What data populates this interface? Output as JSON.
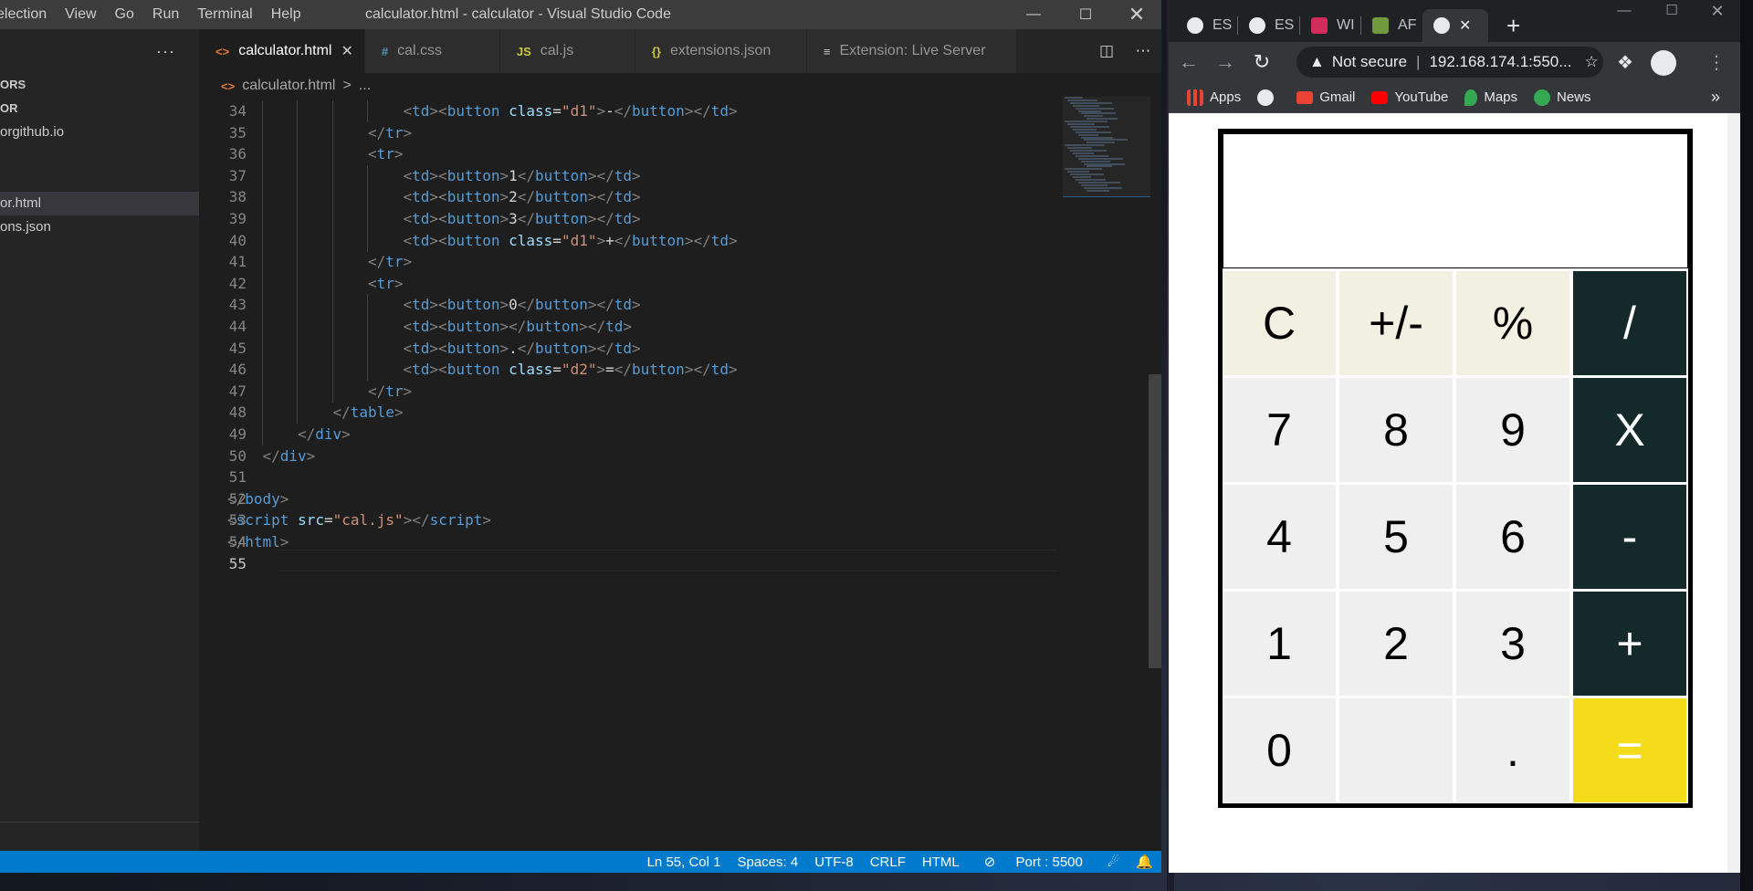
{
  "vscode": {
    "menu": [
      "election",
      "View",
      "Go",
      "Run",
      "Terminal",
      "Help"
    ],
    "title": "calculator.html - calculator - Visual Studio Code",
    "sidebar": {
      "more": "···",
      "rows": [
        "ORS",
        "OR",
        "orgithub.io",
        "",
        "",
        "or.html",
        "ons.json"
      ]
    },
    "tabs": [
      {
        "icon": "<>",
        "label": "calculator.html",
        "close": "✕"
      },
      {
        "icon": "#",
        "label": "cal.css"
      },
      {
        "icon": "JS",
        "label": "cal.js"
      },
      {
        "icon": "{}",
        "label": "extensions.json"
      },
      {
        "icon": "≡",
        "label": "Extension: Live Server"
      }
    ],
    "breadcrumb": {
      "file": "calculator.html",
      "sep": ">",
      "more": "..."
    },
    "status": {
      "position": "Ln 55, Col 1",
      "spaces": "Spaces: 4",
      "encoding": "UTF-8",
      "eol": "CRLF",
      "language": "HTML",
      "port": "Port : 5500"
    }
  },
  "code_lines": [
    {
      "n": "34",
      "indent": 5,
      "tokens": [
        [
          "p",
          "<"
        ],
        [
          "t",
          "td"
        ],
        [
          "p",
          ">"
        ],
        [
          "p",
          "<"
        ],
        [
          "t",
          "button"
        ],
        [
          "x",
          " "
        ],
        [
          "a",
          "class"
        ],
        [
          "x",
          "="
        ],
        [
          "s",
          "\"d1\""
        ],
        [
          "p",
          ">"
        ],
        [
          "x",
          "-"
        ],
        [
          "p",
          "</"
        ],
        [
          "t",
          "button"
        ],
        [
          "p",
          "></"
        ],
        [
          "t",
          "td"
        ],
        [
          "p",
          ">"
        ]
      ]
    },
    {
      "n": "35",
      "indent": 4,
      "tokens": [
        [
          "p",
          "</"
        ],
        [
          "t",
          "tr"
        ],
        [
          "p",
          ">"
        ]
      ]
    },
    {
      "n": "36",
      "indent": 4,
      "tokens": [
        [
          "p",
          "<"
        ],
        [
          "t",
          "tr"
        ],
        [
          "p",
          ">"
        ]
      ]
    },
    {
      "n": "37",
      "indent": 5,
      "tokens": [
        [
          "p",
          "<"
        ],
        [
          "t",
          "td"
        ],
        [
          "p",
          ">"
        ],
        [
          "p",
          "<"
        ],
        [
          "t",
          "button"
        ],
        [
          "p",
          ">"
        ],
        [
          "x",
          "1"
        ],
        [
          "p",
          "</"
        ],
        [
          "t",
          "button"
        ],
        [
          "p",
          "></"
        ],
        [
          "t",
          "td"
        ],
        [
          "p",
          ">"
        ]
      ]
    },
    {
      "n": "38",
      "indent": 5,
      "tokens": [
        [
          "p",
          "<"
        ],
        [
          "t",
          "td"
        ],
        [
          "p",
          ">"
        ],
        [
          "p",
          "<"
        ],
        [
          "t",
          "button"
        ],
        [
          "p",
          ">"
        ],
        [
          "x",
          "2"
        ],
        [
          "p",
          "</"
        ],
        [
          "t",
          "button"
        ],
        [
          "p",
          "></"
        ],
        [
          "t",
          "td"
        ],
        [
          "p",
          ">"
        ]
      ]
    },
    {
      "n": "39",
      "indent": 5,
      "tokens": [
        [
          "p",
          "<"
        ],
        [
          "t",
          "td"
        ],
        [
          "p",
          ">"
        ],
        [
          "p",
          "<"
        ],
        [
          "t",
          "button"
        ],
        [
          "p",
          ">"
        ],
        [
          "x",
          "3"
        ],
        [
          "p",
          "</"
        ],
        [
          "t",
          "button"
        ],
        [
          "p",
          "></"
        ],
        [
          "t",
          "td"
        ],
        [
          "p",
          ">"
        ]
      ]
    },
    {
      "n": "40",
      "indent": 5,
      "tokens": [
        [
          "p",
          "<"
        ],
        [
          "t",
          "td"
        ],
        [
          "p",
          ">"
        ],
        [
          "p",
          "<"
        ],
        [
          "t",
          "button"
        ],
        [
          "x",
          " "
        ],
        [
          "a",
          "class"
        ],
        [
          "x",
          "="
        ],
        [
          "s",
          "\"d1\""
        ],
        [
          "p",
          ">"
        ],
        [
          "x",
          "+"
        ],
        [
          "p",
          "</"
        ],
        [
          "t",
          "button"
        ],
        [
          "p",
          "></"
        ],
        [
          "t",
          "td"
        ],
        [
          "p",
          ">"
        ]
      ]
    },
    {
      "n": "41",
      "indent": 4,
      "tokens": [
        [
          "p",
          "</"
        ],
        [
          "t",
          "tr"
        ],
        [
          "p",
          ">"
        ]
      ]
    },
    {
      "n": "42",
      "indent": 4,
      "tokens": [
        [
          "p",
          "<"
        ],
        [
          "t",
          "tr"
        ],
        [
          "p",
          ">"
        ]
      ]
    },
    {
      "n": "43",
      "indent": 5,
      "tokens": [
        [
          "p",
          "<"
        ],
        [
          "t",
          "td"
        ],
        [
          "p",
          ">"
        ],
        [
          "p",
          "<"
        ],
        [
          "t",
          "button"
        ],
        [
          "p",
          ">"
        ],
        [
          "x",
          "0"
        ],
        [
          "p",
          "</"
        ],
        [
          "t",
          "button"
        ],
        [
          "p",
          "></"
        ],
        [
          "t",
          "td"
        ],
        [
          "p",
          ">"
        ]
      ]
    },
    {
      "n": "44",
      "indent": 5,
      "tokens": [
        [
          "p",
          "<"
        ],
        [
          "t",
          "td"
        ],
        [
          "p",
          ">"
        ],
        [
          "p",
          "<"
        ],
        [
          "t",
          "button"
        ],
        [
          "p",
          "></"
        ],
        [
          "t",
          "button"
        ],
        [
          "p",
          "></"
        ],
        [
          "t",
          "td"
        ],
        [
          "p",
          ">"
        ]
      ]
    },
    {
      "n": "45",
      "indent": 5,
      "tokens": [
        [
          "p",
          "<"
        ],
        [
          "t",
          "td"
        ],
        [
          "p",
          ">"
        ],
        [
          "p",
          "<"
        ],
        [
          "t",
          "button"
        ],
        [
          "p",
          ">"
        ],
        [
          "x",
          "."
        ],
        [
          "p",
          "</"
        ],
        [
          "t",
          "button"
        ],
        [
          "p",
          "></"
        ],
        [
          "t",
          "td"
        ],
        [
          "p",
          ">"
        ]
      ]
    },
    {
      "n": "46",
      "indent": 5,
      "tokens": [
        [
          "p",
          "<"
        ],
        [
          "t",
          "td"
        ],
        [
          "p",
          ">"
        ],
        [
          "p",
          "<"
        ],
        [
          "t",
          "button"
        ],
        [
          "x",
          " "
        ],
        [
          "a",
          "class"
        ],
        [
          "x",
          "="
        ],
        [
          "s",
          "\"d2\""
        ],
        [
          "p",
          ">"
        ],
        [
          "x",
          "="
        ],
        [
          "p",
          "</"
        ],
        [
          "t",
          "button"
        ],
        [
          "p",
          "></"
        ],
        [
          "t",
          "td"
        ],
        [
          "p",
          ">"
        ]
      ]
    },
    {
      "n": "47",
      "indent": 4,
      "tokens": [
        [
          "p",
          "</"
        ],
        [
          "t",
          "tr"
        ],
        [
          "p",
          ">"
        ]
      ]
    },
    {
      "n": "48",
      "indent": 3,
      "tokens": [
        [
          "p",
          "</"
        ],
        [
          "t",
          "table"
        ],
        [
          "p",
          ">"
        ]
      ]
    },
    {
      "n": "49",
      "indent": 2,
      "tokens": [
        [
          "p",
          "</"
        ],
        [
          "t",
          "div"
        ],
        [
          "p",
          ">"
        ]
      ]
    },
    {
      "n": "50",
      "indent": 1,
      "tokens": [
        [
          "p",
          "</"
        ],
        [
          "t",
          "div"
        ],
        [
          "p",
          ">"
        ]
      ]
    },
    {
      "n": "51",
      "indent": 0,
      "tokens": []
    },
    {
      "n": "52",
      "indent": 0,
      "tokens": [
        [
          "p",
          "</"
        ],
        [
          "t",
          "body"
        ],
        [
          "p",
          ">"
        ]
      ]
    },
    {
      "n": "53",
      "indent": 0,
      "tokens": [
        [
          "p",
          "<"
        ],
        [
          "t",
          "script"
        ],
        [
          "x",
          " "
        ],
        [
          "a",
          "src"
        ],
        [
          "x",
          "="
        ],
        [
          "s",
          "\"cal.js\""
        ],
        [
          "p",
          "></"
        ],
        [
          "t",
          "script"
        ],
        [
          "p",
          ">"
        ]
      ]
    },
    {
      "n": "54",
      "indent": 0,
      "tokens": [
        [
          "p",
          "</"
        ],
        [
          "t",
          "html"
        ],
        [
          "p",
          ">"
        ]
      ]
    },
    {
      "n": "55",
      "indent": 0,
      "tokens": []
    }
  ],
  "chrome": {
    "tabs": [
      {
        "label": "ES",
        "favicon": "globe-icon"
      },
      {
        "label": "ES",
        "favicon": "globe-icon"
      },
      {
        "label": "WI",
        "favicon": "site-icon"
      },
      {
        "label": "AF",
        "favicon": "site-icon"
      },
      {
        "label": "",
        "favicon": "globe-icon",
        "close": "✕"
      }
    ],
    "new_tab": "+",
    "security": "Not secure",
    "url": "192.168.174.1:550...",
    "bookmarks": [
      "Apps",
      "",
      "Gmail",
      "YouTube",
      "Maps",
      "News"
    ],
    "bookmarks_more": "»"
  },
  "calculator": {
    "display": "",
    "keys": [
      {
        "label": "C",
        "kind": "func"
      },
      {
        "label": "+/-",
        "kind": "func"
      },
      {
        "label": "%",
        "kind": "func"
      },
      {
        "label": "/",
        "kind": "op"
      },
      {
        "label": "7",
        "kind": "num"
      },
      {
        "label": "8",
        "kind": "num"
      },
      {
        "label": "9",
        "kind": "num"
      },
      {
        "label": "X",
        "kind": "op"
      },
      {
        "label": "4",
        "kind": "num"
      },
      {
        "label": "5",
        "kind": "num"
      },
      {
        "label": "6",
        "kind": "num"
      },
      {
        "label": "-",
        "kind": "op"
      },
      {
        "label": "1",
        "kind": "num"
      },
      {
        "label": "2",
        "kind": "num"
      },
      {
        "label": "3",
        "kind": "num"
      },
      {
        "label": "+",
        "kind": "op"
      },
      {
        "label": "0",
        "kind": "num"
      },
      {
        "label": "",
        "kind": "num"
      },
      {
        "label": ".",
        "kind": "num"
      },
      {
        "label": "=",
        "kind": "eq"
      }
    ]
  },
  "colors": {
    "vscode_accent": "#007acc",
    "calc_func": "#f1f0e1",
    "calc_op": "#13292a",
    "calc_eq": "#f4dc1a"
  }
}
